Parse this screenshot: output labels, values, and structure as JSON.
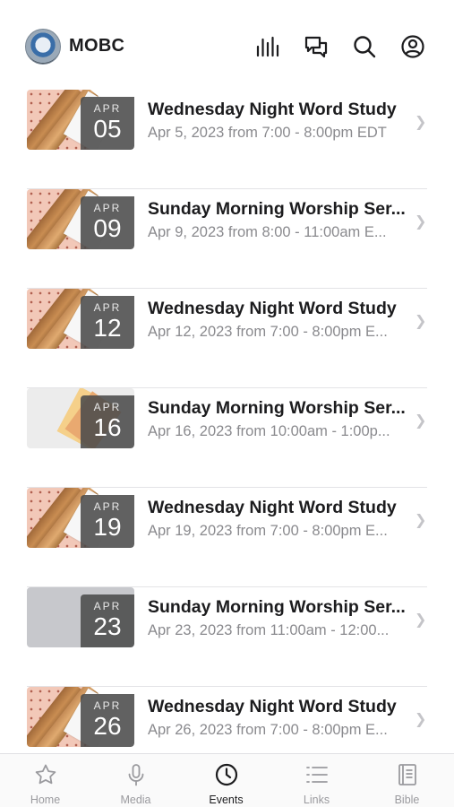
{
  "header": {
    "app_title": "MOBC",
    "icons": [
      "audio-bars-icon",
      "chat-icon",
      "search-icon",
      "profile-icon"
    ]
  },
  "events": [
    {
      "month": "APR",
      "day": "05",
      "title": "Wednesday Night Word Study",
      "subtitle": "Apr 5, 2023 from 7:00 - 8:00pm EDT",
      "thumb": "wood"
    },
    {
      "month": "APR",
      "day": "09",
      "title": "Sunday Morning Worship Ser...",
      "subtitle": "Apr 9, 2023 from 8:00 - 11:00am E...",
      "thumb": "wood"
    },
    {
      "month": "APR",
      "day": "12",
      "title": "Wednesday Night Word Study",
      "subtitle": "Apr 12, 2023 from 7:00 - 8:00pm E...",
      "thumb": "wood"
    },
    {
      "month": "APR",
      "day": "16",
      "title": "Sunday Morning Worship Ser...",
      "subtitle": "Apr 16, 2023 from 10:00am - 1:00p...",
      "thumb": "light"
    },
    {
      "month": "APR",
      "day": "19",
      "title": "Wednesday Night Word Study",
      "subtitle": "Apr 19, 2023 from 7:00 - 8:00pm E...",
      "thumb": "wood"
    },
    {
      "month": "APR",
      "day": "23",
      "title": "Sunday Morning Worship Ser...",
      "subtitle": "Apr 23, 2023 from 11:00am - 12:00...",
      "thumb": "plain"
    },
    {
      "month": "APR",
      "day": "26",
      "title": "Wednesday Night Word Study",
      "subtitle": "Apr 26, 2023 from 7:00 - 8:00pm E...",
      "thumb": "wood"
    }
  ],
  "tabbar": {
    "tabs": [
      {
        "label": "Home",
        "icon": "star-icon",
        "active": false
      },
      {
        "label": "Media",
        "icon": "microphone-icon",
        "active": false
      },
      {
        "label": "Events",
        "icon": "clock-icon",
        "active": true
      },
      {
        "label": "Links",
        "icon": "list-icon",
        "active": false
      },
      {
        "label": "Bible",
        "icon": "book-icon",
        "active": false
      }
    ]
  },
  "colors": {
    "active": "#1c1c1e",
    "inactive": "#9a9a9e",
    "subtitle": "#8a8a8e",
    "date_badge": "#4b4b4b"
  }
}
